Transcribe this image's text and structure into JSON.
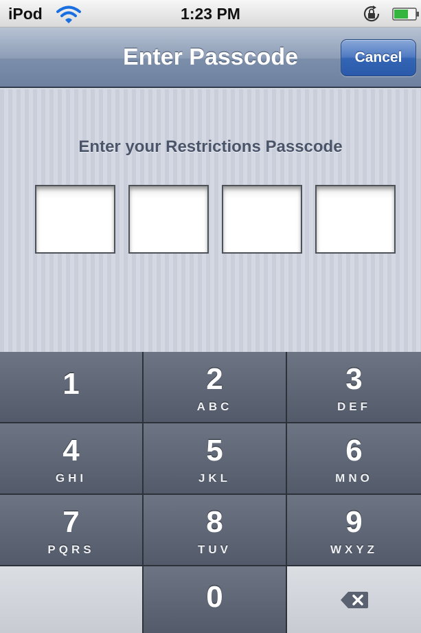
{
  "status_bar": {
    "carrier": "iPod",
    "time": "1:23 PM",
    "icons": [
      "wifi-icon",
      "rotation-lock-icon",
      "battery-icon"
    ]
  },
  "nav_bar": {
    "title": "Enter Passcode",
    "cancel_label": "Cancel"
  },
  "prompt": "Enter your Restrictions Passcode",
  "passcode_digits_filled": 0,
  "keypad": {
    "keys": [
      {
        "digit": "1",
        "letters": ""
      },
      {
        "digit": "2",
        "letters": "ABC"
      },
      {
        "digit": "3",
        "letters": "DEF"
      },
      {
        "digit": "4",
        "letters": "GHI"
      },
      {
        "digit": "5",
        "letters": "JKL"
      },
      {
        "digit": "6",
        "letters": "MNO"
      },
      {
        "digit": "7",
        "letters": "PQRS"
      },
      {
        "digit": "8",
        "letters": "TUV"
      },
      {
        "digit": "9",
        "letters": "WXYZ"
      },
      {
        "digit": "0",
        "letters": ""
      }
    ],
    "delete_icon": "backspace-icon"
  },
  "colors": {
    "nav_bar": "#8d9db6",
    "cancel_button": "#3465b5",
    "keypad_key": "#5f6676",
    "keypad_light_key": "#d2d5db",
    "prompt_text": "#4b5569"
  }
}
